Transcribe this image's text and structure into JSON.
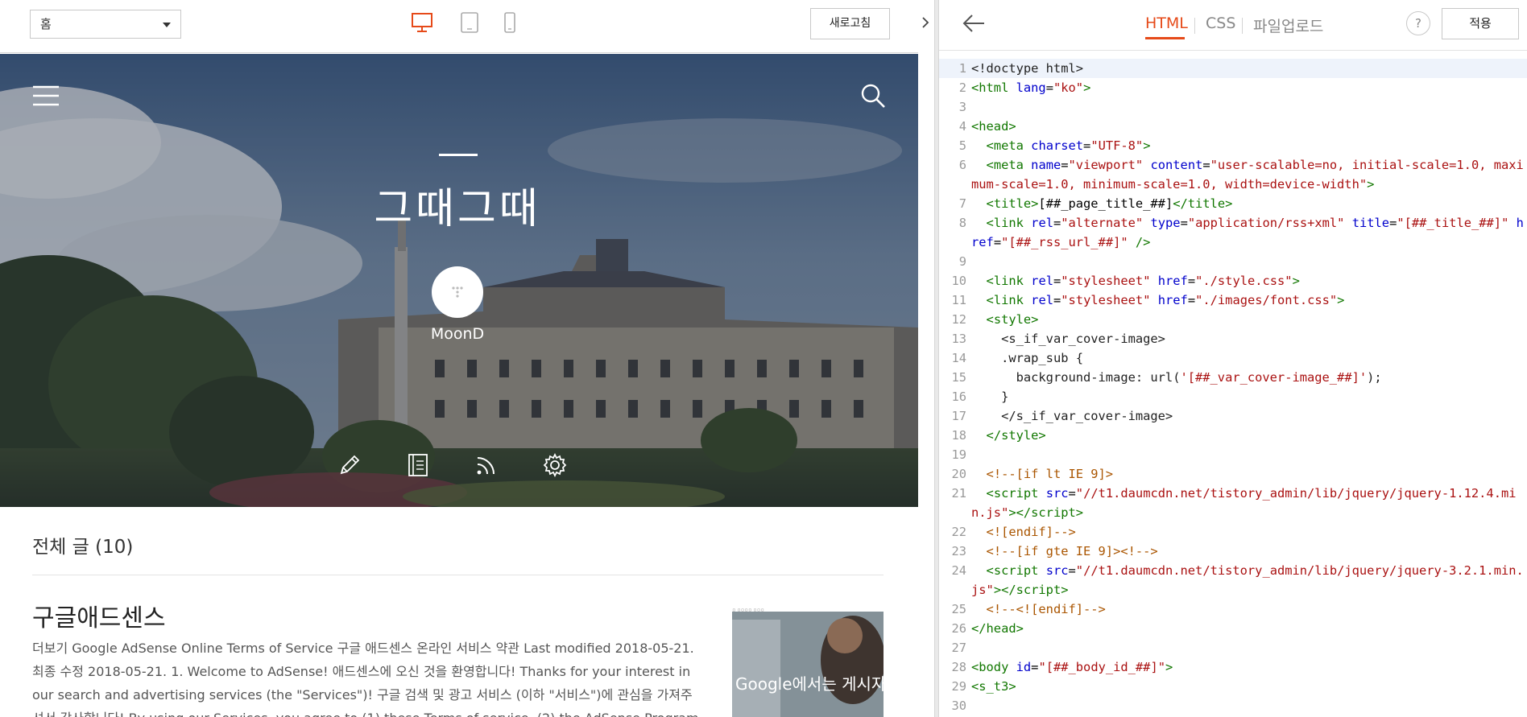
{
  "toolbar": {
    "page_select_value": "홈",
    "refresh_label": "새로고침",
    "devices": [
      "desktop",
      "tablet",
      "mobile"
    ],
    "active_device": "desktop",
    "active_color": "#e64a19"
  },
  "hero": {
    "title": "그때그때",
    "author": "MoonD",
    "tools": [
      "pencil-icon",
      "notebook-icon",
      "rss-icon",
      "gear-icon"
    ]
  },
  "posts": {
    "section_title": "전체 글 (10)",
    "items": [
      {
        "title": "구글애드센스",
        "excerpt": "더보기 Google AdSense Online Terms of Service 구글 애드센스 온라인 서비스 약관 Last modified 2018-05-21. 최종 수정 2018-05-21. 1. Welcome to AdSense! 애드센스에 오신 것을 환영합니다! Thanks for your interest in our search and advertising services (the \"Services\")! 구글 검색 및 광고 서비스 (이하 \"서비스\")에 관심을 가져주셔서 감사합니다! By using our Services, you agree to (1) these Terms of service, (2) the AdSense Program Policies, which includ…",
        "thumb_caption": "Google에서는 게시자의 콘텐츠를 소중하게 생각합니다",
        "thumb_header": "ㅁ    ㅁㅁㅁㅁ    ㅁㅁㅁ"
      }
    ]
  },
  "editor": {
    "tabs": [
      "HTML",
      "CSS",
      "파일업로드"
    ],
    "active_tab": "HTML",
    "help_label": "?",
    "apply_label": "적용",
    "lines": [
      {
        "n": "1",
        "html": "<span class='tx'>&lt;!doctype html&gt;</span>"
      },
      {
        "n": "2",
        "html": "<span class='tg'>&lt;html</span> <span class='at'>lang</span>=<span class='st'>\"ko\"</span><span class='tg'>&gt;</span>"
      },
      {
        "n": "3",
        "html": ""
      },
      {
        "n": "4",
        "html": "<span class='tg'>&lt;head&gt;</span>"
      },
      {
        "n": "5",
        "html": "  <span class='tg'>&lt;meta</span> <span class='at'>charset</span>=<span class='st'>\"UTF-8\"</span><span class='tg'>&gt;</span>"
      },
      {
        "n": "6",
        "html": "  <span class='tg'>&lt;meta</span> <span class='at'>name</span>=<span class='st'>\"viewport\"</span> <span class='at'>content</span>=<span class='st'>\"user-scalable=no, initial-scale=1.0, maximum-scale=1.0, minimum-scale=1.0, width=device-width\"</span><span class='tg'>&gt;</span>"
      },
      {
        "n": "7",
        "html": "  <span class='tg'>&lt;title&gt;</span>[##_page_title_##]<span class='tg'>&lt;/title&gt;</span>"
      },
      {
        "n": "8",
        "html": "  <span class='tg'>&lt;link</span> <span class='at'>rel</span>=<span class='st'>\"alternate\"</span> <span class='at'>type</span>=<span class='st'>\"application/rss+xml\"</span> <span class='at'>title</span>=<span class='st'>\"[##_title_##]\"</span> <span class='at'>href</span>=<span class='st'>\"[##_rss_url_##]\"</span> <span class='tg'>/&gt;</span>"
      },
      {
        "n": "9",
        "html": ""
      },
      {
        "n": "10",
        "html": "  <span class='tg'>&lt;link</span> <span class='at'>rel</span>=<span class='st'>\"stylesheet\"</span> <span class='at'>href</span>=<span class='st'>\"./style.css\"</span><span class='tg'>&gt;</span>"
      },
      {
        "n": "11",
        "html": "  <span class='tg'>&lt;link</span> <span class='at'>rel</span>=<span class='st'>\"stylesheet\"</span> <span class='at'>href</span>=<span class='st'>\"./images/font.css\"</span><span class='tg'>&gt;</span>"
      },
      {
        "n": "12",
        "html": "  <span class='tg'>&lt;style&gt;</span>"
      },
      {
        "n": "13",
        "html": "    <span class='tx'>&lt;s_if_var_cover-image&gt;</span>"
      },
      {
        "n": "14",
        "html": "    <span class='tx'>.wrap_sub {</span>"
      },
      {
        "n": "15",
        "html": "      <span class='tx'>background-image: url(</span><span class='st'>'[##_var_cover-image_##]'</span><span class='tx'>);</span>"
      },
      {
        "n": "16",
        "html": "    <span class='tx'>}</span>"
      },
      {
        "n": "17",
        "html": "    <span class='tx'>&lt;/s_if_var_cover-image&gt;</span>"
      },
      {
        "n": "18",
        "html": "  <span class='tg'>&lt;/style&gt;</span>"
      },
      {
        "n": "19",
        "html": ""
      },
      {
        "n": "20",
        "html": "  <span class='cm'>&lt;!--[if lt IE 9]&gt;</span>"
      },
      {
        "n": "21",
        "html": "  <span class='tg'>&lt;script</span> <span class='at'>src</span>=<span class='st'>\"//t1.daumcdn.net/tistory_admin/lib/jquery/jquery-1.12.4.min.js\"</span><span class='tg'>&gt;&lt;/script&gt;</span>"
      },
      {
        "n": "22",
        "html": "  <span class='cm'>&lt;![endif]--&gt;</span>"
      },
      {
        "n": "23",
        "html": "  <span class='cm'>&lt;!--[if gte IE 9]&gt;&lt;!--&gt;</span>"
      },
      {
        "n": "24",
        "html": "  <span class='tg'>&lt;script</span> <span class='at'>src</span>=<span class='st'>\"//t1.daumcdn.net/tistory_admin/lib/jquery/jquery-3.2.1.min.js\"</span><span class='tg'>&gt;&lt;/script&gt;</span>"
      },
      {
        "n": "25",
        "html": "  <span class='cm'>&lt;!--&lt;![endif]--&gt;</span>"
      },
      {
        "n": "26",
        "html": "<span class='tg'>&lt;/head&gt;</span>"
      },
      {
        "n": "27",
        "html": ""
      },
      {
        "n": "28",
        "html": "<span class='tg'>&lt;body</span> <span class='at'>id</span>=<span class='st'>\"[##_body_id_##]\"</span><span class='tg'>&gt;</span>"
      },
      {
        "n": "29",
        "html": "<span class='tg'>&lt;s_t3&gt;</span>"
      },
      {
        "n": "30",
        "html": ""
      }
    ]
  }
}
